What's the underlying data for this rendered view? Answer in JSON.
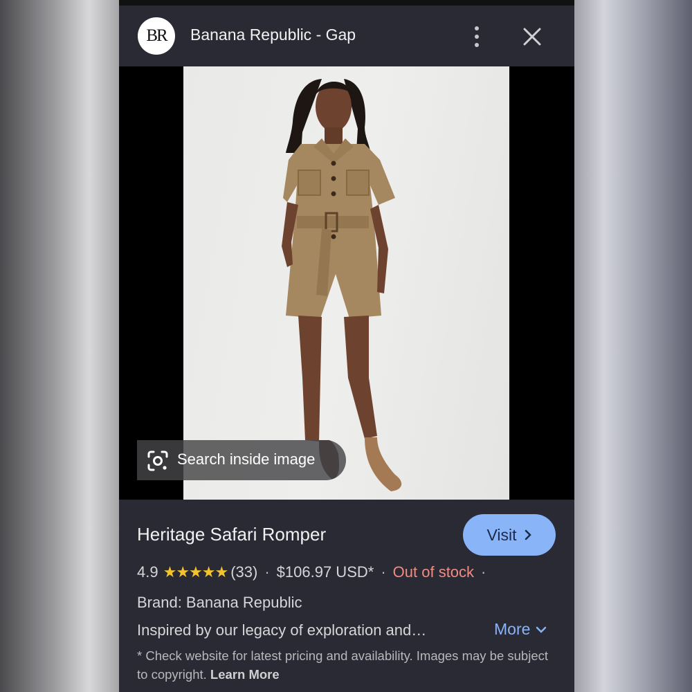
{
  "header": {
    "logo_text": "BR",
    "title": "Banana Republic - Gap",
    "menu_icon": "more-vert-icon",
    "close_icon": "close-icon"
  },
  "image": {
    "search_inside_label": "Search inside image",
    "search_icon": "google-lens-icon"
  },
  "product": {
    "title": "Heritage Safari Romper",
    "visit_label": "Visit",
    "rating": "4.9",
    "stars": "★★★★★",
    "review_count": "(33)",
    "price": "$106.97 USD*",
    "stock_status": "Out of stock",
    "brand": "Brand: Banana Republic",
    "description": "Inspired by our legacy of exploration and…",
    "more_label": "More",
    "disclaimer": "* Check website for latest pricing and availability. Images may be subject to copyright.",
    "learn_more_label": "Learn More"
  },
  "colors": {
    "accent_blue": "#8ab4f8",
    "out_of_stock_red": "#f28b82",
    "star_yellow": "#f4c430",
    "panel_bg": "#292a33"
  }
}
